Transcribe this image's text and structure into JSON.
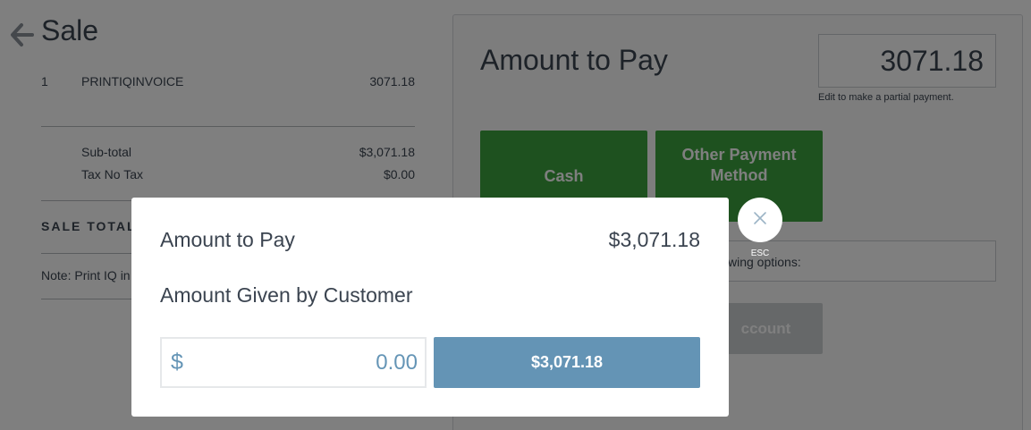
{
  "sale": {
    "title": "Sale",
    "items": [
      {
        "qty": "1",
        "name": "PRINTIQINVOICE",
        "amount": "3071.18"
      }
    ],
    "subtotal_label": "Sub-total",
    "subtotal_value": "$3,071.18",
    "tax_label": "Tax No Tax",
    "tax_value": "$0.00",
    "total_label": "SALE TOTAL",
    "note": "Note: Print IQ in"
  },
  "payment": {
    "title": "Amount to Pay",
    "amount": "3071.18",
    "hint": "Edit to make a partial payment.",
    "cash_label": "Cash",
    "other_label": "Other Payment Method",
    "options_text": "wing options:",
    "account_label": "ccount"
  },
  "modal": {
    "amount_label": "Amount to Pay",
    "amount_value": "$3,071.18",
    "given_label": "Amount Given by Customer",
    "currency_symbol": "$",
    "given_placeholder": "0.00",
    "exact_button": "$3,071.18",
    "close_label": "ESC"
  },
  "colors": {
    "green": "#3ca33f",
    "blue_button": "#6494b5",
    "text": "#3b4450"
  }
}
